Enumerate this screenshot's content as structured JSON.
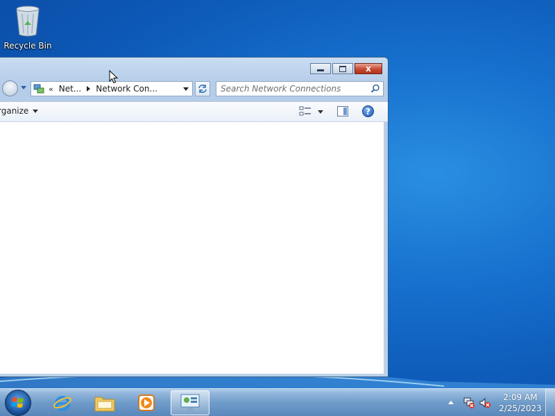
{
  "desktop": {
    "recycle_bin_label": "Recycle Bin"
  },
  "window": {
    "address": {
      "chevron": "«",
      "crumbs": [
        "Net...",
        "Network Con..."
      ]
    },
    "search": {
      "placeholder": "Search Network Connections"
    },
    "toolbar": {
      "organize_label": "rganize",
      "help_glyph": "?"
    },
    "caption": {
      "close_glyph": "x"
    }
  },
  "taskbar": {
    "pinned": [
      "internet-explorer",
      "windows-explorer",
      "media-player",
      "network-connections"
    ],
    "clock": {
      "time": "2:09 AM",
      "date": "2/25/2023"
    }
  },
  "colors": {
    "desktop_blue": "#1872cf",
    "close_red": "#c74a32",
    "window_frame": "#b6cde9"
  }
}
